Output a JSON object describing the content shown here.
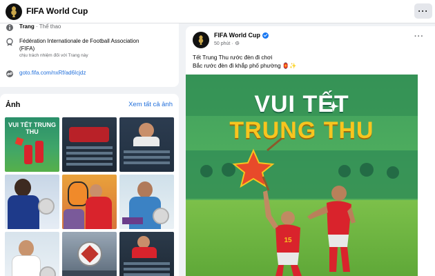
{
  "header": {
    "page_name": "FIFA World Cup",
    "more_label": "···"
  },
  "intro": {
    "category_label": "Trang",
    "category_value": "· Thể thao",
    "org_name": "Fédération Internationale de Football Association",
    "org_short": "(FIFA)",
    "org_sub": "chịu trách nhiệm đối với Trang này",
    "link": "goto.fifa.com/nxRf/ad6Icjdz"
  },
  "photos": {
    "title": "Ảnh",
    "see_all": "Xem tất cả ảnh",
    "tile1_text": "VUI TẾT TRUNG THU"
  },
  "post": {
    "author": "FIFA World Cup",
    "time": "50 phút ·",
    "line1": "Tết Trung Thu rước đèn đi chơi",
    "line2": "Bắc rước đèn đi khắp phố phường 🏮✨",
    "image_title1": "VUI TẾT",
    "image_title2": "TRUNG THU",
    "player1_number": "15",
    "more_label": "···"
  },
  "colors": {
    "link": "#216fdb",
    "verified": "#1877f2",
    "title_white": "#ffffff",
    "title_yellow": "#f7c51f",
    "jersey_red": "#d9232c"
  }
}
